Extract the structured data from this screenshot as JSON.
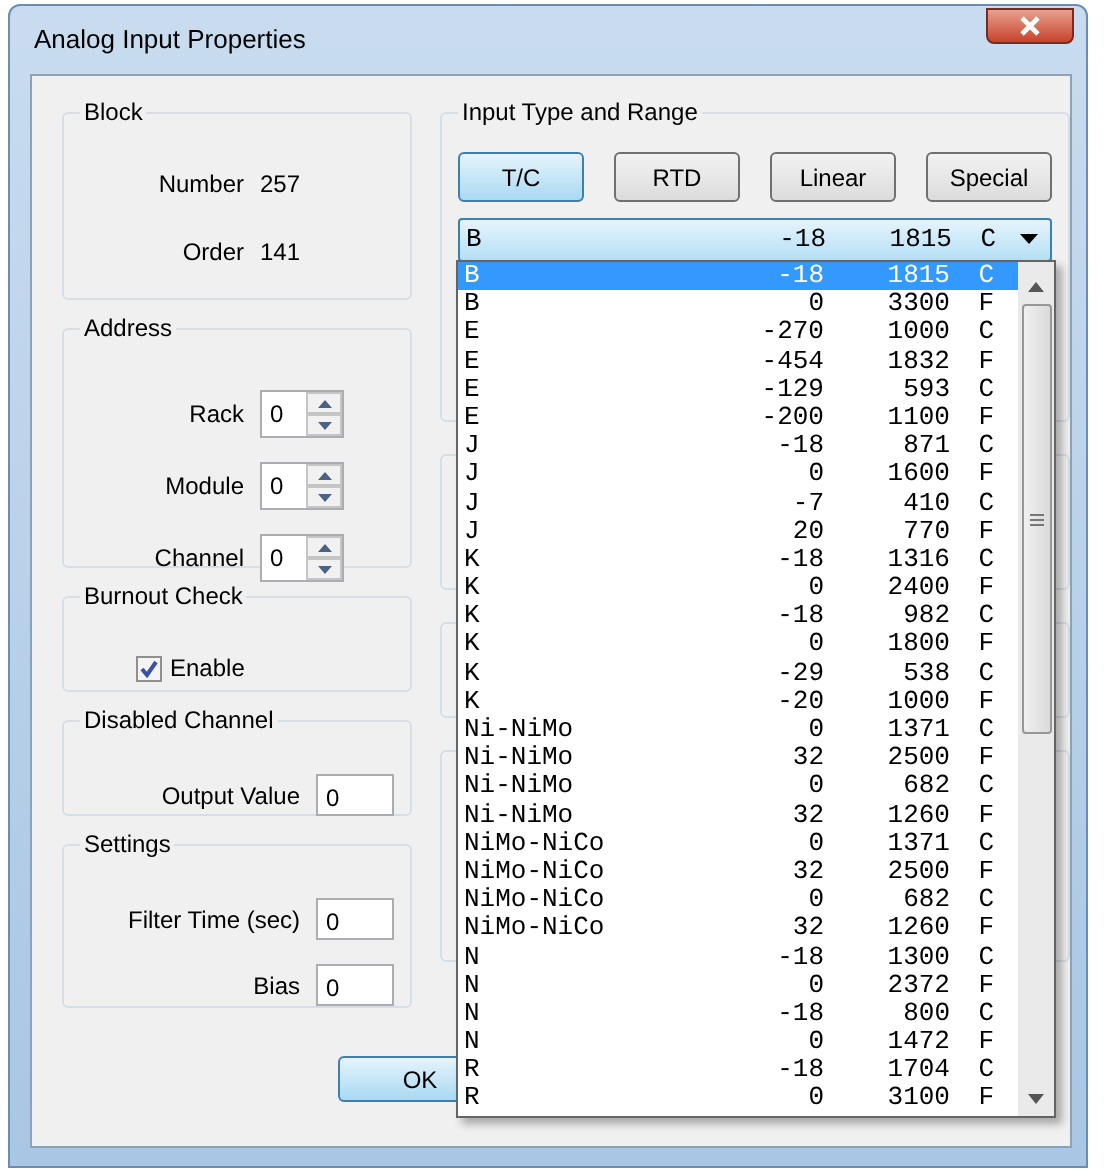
{
  "window": {
    "title": "Analog Input Properties"
  },
  "block": {
    "title": "Block",
    "fields": [
      {
        "label": "Number",
        "value": "257"
      },
      {
        "label": "Order",
        "value": "141"
      }
    ]
  },
  "address": {
    "title": "Address",
    "fields": [
      {
        "label": "Rack",
        "value": "0"
      },
      {
        "label": "Module",
        "value": "0"
      },
      {
        "label": "Channel",
        "value": "0"
      }
    ]
  },
  "burnout_check": {
    "title": "Burnout Check",
    "checkbox": {
      "label": "Enable",
      "checked": true
    }
  },
  "disabled_channel": {
    "title": "Disabled Channel",
    "fields": [
      {
        "label": "Output Value",
        "value": "0"
      }
    ]
  },
  "settings": {
    "title": "Settings",
    "fields": [
      {
        "label": "Filter Time (sec)",
        "value": "0"
      },
      {
        "label": "Bias",
        "value": "0"
      }
    ]
  },
  "input_type": {
    "title": "Input Type and Range",
    "buttons": [
      {
        "label": "T/C",
        "selected": true
      },
      {
        "label": "RTD",
        "selected": false
      },
      {
        "label": "Linear",
        "selected": false
      },
      {
        "label": "Special",
        "selected": false
      }
    ],
    "combo": {
      "type": "B",
      "low": "-18",
      "high": "1815",
      "unit": "C"
    },
    "options": [
      {
        "type": "B",
        "low": "-18",
        "high": "1815",
        "unit": "C",
        "selected": true
      },
      {
        "type": "B",
        "low": "0",
        "high": "3300",
        "unit": "F",
        "selected": false
      },
      {
        "type": "E",
        "low": "-270",
        "high": "1000",
        "unit": "C",
        "selected": false
      },
      {
        "type": "E",
        "low": "-454",
        "high": "1832",
        "unit": "F",
        "selected": false
      },
      {
        "type": "E",
        "low": "-129",
        "high": "593",
        "unit": "C",
        "selected": false
      },
      {
        "type": "E",
        "low": "-200",
        "high": "1100",
        "unit": "F",
        "selected": false
      },
      {
        "type": "J",
        "low": "-18",
        "high": "871",
        "unit": "C",
        "selected": false
      },
      {
        "type": "J",
        "low": "0",
        "high": "1600",
        "unit": "F",
        "selected": false
      },
      {
        "type": "J",
        "low": "-7",
        "high": "410",
        "unit": "C",
        "selected": false
      },
      {
        "type": "J",
        "low": "20",
        "high": "770",
        "unit": "F",
        "selected": false
      },
      {
        "type": "K",
        "low": "-18",
        "high": "1316",
        "unit": "C",
        "selected": false
      },
      {
        "type": "K",
        "low": "0",
        "high": "2400",
        "unit": "F",
        "selected": false
      },
      {
        "type": "K",
        "low": "-18",
        "high": "982",
        "unit": "C",
        "selected": false
      },
      {
        "type": "K",
        "low": "0",
        "high": "1800",
        "unit": "F",
        "selected": false
      },
      {
        "type": "K",
        "low": "-29",
        "high": "538",
        "unit": "C",
        "selected": false
      },
      {
        "type": "K",
        "low": "-20",
        "high": "1000",
        "unit": "F",
        "selected": false
      },
      {
        "type": "Ni-NiMo",
        "low": "0",
        "high": "1371",
        "unit": "C",
        "selected": false
      },
      {
        "type": "Ni-NiMo",
        "low": "32",
        "high": "2500",
        "unit": "F",
        "selected": false
      },
      {
        "type": "Ni-NiMo",
        "low": "0",
        "high": "682",
        "unit": "C",
        "selected": false
      },
      {
        "type": "Ni-NiMo",
        "low": "32",
        "high": "1260",
        "unit": "F",
        "selected": false
      },
      {
        "type": "NiMo-NiCo",
        "low": "0",
        "high": "1371",
        "unit": "C",
        "selected": false
      },
      {
        "type": "NiMo-NiCo",
        "low": "32",
        "high": "2500",
        "unit": "F",
        "selected": false
      },
      {
        "type": "NiMo-NiCo",
        "low": "0",
        "high": "682",
        "unit": "C",
        "selected": false
      },
      {
        "type": "NiMo-NiCo",
        "low": "32",
        "high": "1260",
        "unit": "F",
        "selected": false
      },
      {
        "type": "N",
        "low": "-18",
        "high": "1300",
        "unit": "C",
        "selected": false
      },
      {
        "type": "N",
        "low": "0",
        "high": "2372",
        "unit": "F",
        "selected": false
      },
      {
        "type": "N",
        "low": "-18",
        "high": "800",
        "unit": "C",
        "selected": false
      },
      {
        "type": "N",
        "low": "0",
        "high": "1472",
        "unit": "F",
        "selected": false
      },
      {
        "type": "R",
        "low": "-18",
        "high": "1704",
        "unit": "C",
        "selected": false
      },
      {
        "type": "R",
        "low": "0",
        "high": "3100",
        "unit": "F",
        "selected": false
      }
    ]
  },
  "buttons": [
    {
      "label": "OK"
    }
  ]
}
